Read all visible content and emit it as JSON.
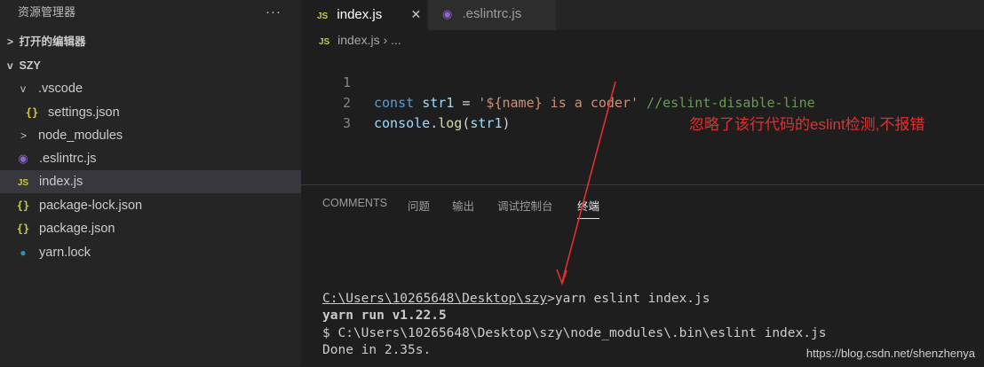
{
  "sidebar": {
    "title": "资源管理器",
    "more": "···",
    "open_editors": "打开的编辑器",
    "project": "SZY",
    "items": [
      {
        "label": ".vscode",
        "icon": "folder-open"
      },
      {
        "label": "settings.json",
        "icon": "json-icon",
        "glyph": "{}"
      },
      {
        "label": "node_modules",
        "icon": "folder-closed"
      },
      {
        "label": ".eslintrc.js",
        "icon": "eslint-icon",
        "glyph": "◉"
      },
      {
        "label": "index.js",
        "icon": "js-icon",
        "glyph": "JS"
      },
      {
        "label": "package-lock.json",
        "icon": "json-icon",
        "glyph": "{}"
      },
      {
        "label": "package.json",
        "icon": "json-icon",
        "glyph": "{}"
      },
      {
        "label": "yarn.lock",
        "icon": "yarn-icon",
        "glyph": "🐈"
      }
    ]
  },
  "tabs": {
    "active": {
      "label": "index.js",
      "icon_text": "JS",
      "close": "✕"
    },
    "inactive": {
      "label": ".eslintrc.js",
      "icon_text": "◉"
    }
  },
  "breadcrumb": {
    "icon_text": "JS",
    "file": "index.js",
    "sep": "› ..."
  },
  "code": {
    "lines": [
      {
        "num": "1",
        "kw": "const",
        "var": "str1",
        "op": " = ",
        "str": "'${name} is a coder'",
        "cm": " //eslint-disable-line"
      },
      {
        "num": "2",
        "fn": "console",
        "dot": ".",
        "fn2": "log",
        "open": "(",
        "var": "str1",
        "close": ")"
      },
      {
        "num": "3"
      }
    ]
  },
  "annotation": "忽略了该行代码的eslint检测,不报错",
  "panel": {
    "tabs": [
      "COMMENTS",
      "问题",
      "输出",
      "调试控制台",
      "终端"
    ],
    "active_tab": "终端",
    "terminal": [
      {
        "prompt": "C:\\Users\\10265648\\Desktop\\szy",
        "cmd": ">yarn eslint index.js"
      },
      {
        "text": "yarn run v1.22.5"
      },
      {
        "text": "$ C:\\Users\\10265648\\Desktop\\szy\\node_modules\\.bin\\eslint index.js"
      },
      {
        "text": "Done in 2.35s."
      }
    ]
  },
  "watermark": "https://blog.csdn.net/shenzhenya",
  "colors": {
    "keyword": "#569cd6",
    "variable": "#9cdcfe",
    "string": "#ce9178",
    "comment": "#6a9955",
    "annotation": "#e62e2e"
  }
}
